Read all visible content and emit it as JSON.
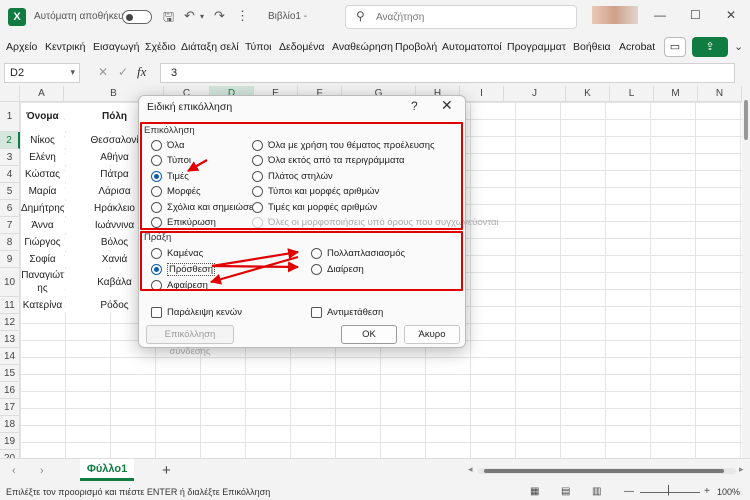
{
  "titlebar": {
    "logo": "X",
    "autosave_label": "Αυτόματη αποθήκευση",
    "doc_title": "Βιβλίο1 -",
    "search_placeholder": "Αναζήτηση",
    "minimize": "—",
    "maximize": "☐",
    "close": "✕"
  },
  "ribbon": {
    "tabs": [
      "Αρχείο",
      "Κεντρική",
      "Εισαγωγή",
      "Σχέδιο",
      "Διάταξη σελί",
      "Τύποι",
      "Δεδομένα",
      "Αναθεώρηση",
      "Προβολή",
      "Αυτοματοποί",
      "Προγραμματ",
      "Βοήθεια",
      "Acrobat"
    ],
    "comment_icon": "▭",
    "share_icon": "⇪",
    "more": "⌄"
  },
  "formula_bar": {
    "name_box": "D2",
    "cancel": "✕",
    "enter": "✓",
    "fx": "fx",
    "value": "3"
  },
  "sheet": {
    "columns": [
      "A",
      "B",
      "C",
      "D",
      "E",
      "F",
      "G",
      "H",
      "I",
      "J",
      "K",
      "L",
      "M",
      "N"
    ],
    "selected_column": "D",
    "rows": [
      "1",
      "2",
      "3",
      "4",
      "5",
      "6",
      "7",
      "8",
      "9",
      "10",
      "11",
      "12",
      "13",
      "14",
      "15",
      "16",
      "17",
      "18",
      "19",
      "20"
    ],
    "selected_row": "2",
    "header_a": "Όνομα",
    "header_b": "Πόλη",
    "names": [
      "Νίκος",
      "Ελένη",
      "Κώστας",
      "Μαρία",
      "Δημήτρης",
      "Άννα",
      "Γιώργος",
      "Σοφία",
      "Παναγιώτ",
      "ης",
      "Κατερίνα"
    ],
    "cities": [
      "Θεσσαλονί",
      "Αθήνα",
      "Πάτρα",
      "Λάρισα",
      "Ηράκλειο",
      "Ιωάννινα",
      "Βόλος",
      "Χανιά",
      "Καβάλα",
      "Ρόδος"
    ]
  },
  "sheet_tabs": {
    "prev": "‹",
    "next": "›",
    "active": "Φύλλο1",
    "add": "+"
  },
  "status_bar": {
    "message": "Επιλέξτε τον προορισμό και πιέστε ENTER ή διαλέξτε Επικόλληση",
    "zoom_minus": "—",
    "zoom_plus": "+",
    "zoom": "100%"
  },
  "dialog": {
    "title": "Ειδική επικόλληση",
    "help": "?",
    "close": "✕",
    "paste_group": "Επικόλληση",
    "paste_left": [
      "Όλα",
      "Τύποι",
      "Τιμές",
      "Μορφές",
      "Σχόλια και σημειώσεις",
      "Επικύρωση"
    ],
    "paste_right": [
      "Όλα με χρήση του θέματος προέλευσης",
      "Όλα εκτός από τα περιγράμματα",
      "Πλάτος στηλών",
      "Τύποι και μορφές αριθμών",
      "Τιμές και μορφές αριθμών",
      "Όλες οι μορφοποιήσεις υπό όρους που συγχωνεύονται"
    ],
    "paste_selected": "Τιμές",
    "operation_group": "Πράξη",
    "operation_left": [
      "Καμένας",
      "Πρόσθεση",
      "Αφαίρεση"
    ],
    "operation_right": [
      "Πολλαπλασιασμός",
      "Διαίρεση"
    ],
    "operation_selected": "Πρόσθεση",
    "skip_blanks": "Παράλειψη κενών",
    "transpose": "Αντιμετάθεση",
    "paste_link": "Επικόλληση σύνδεσης",
    "ok": "OK",
    "cancel": "Άκυρο"
  },
  "colors": {
    "accent": "#107c41",
    "annotation": "#e00000",
    "radio_selected": "#0b5cad"
  }
}
